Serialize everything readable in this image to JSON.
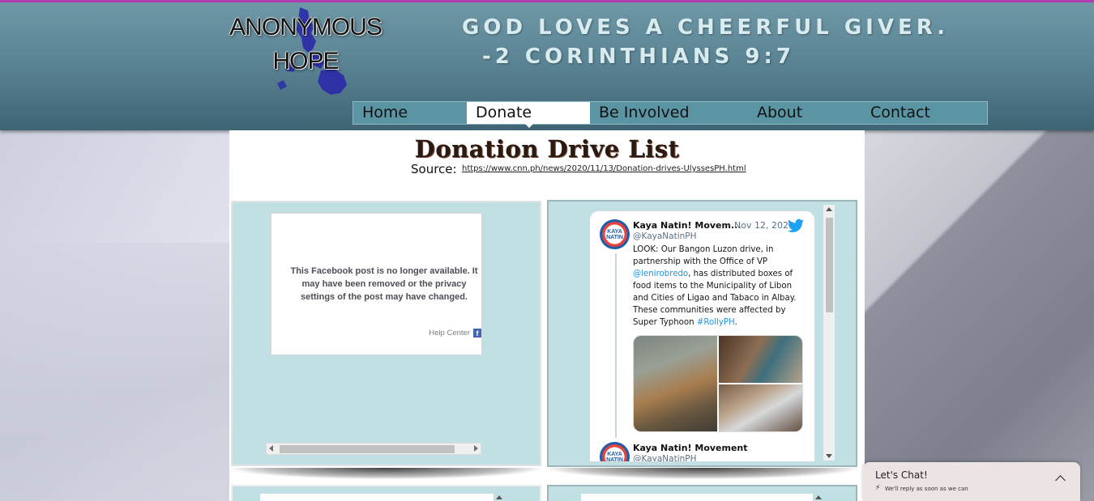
{
  "site": {
    "logo_line1": "ANONYMOUS",
    "logo_line2": "HOPE",
    "verse_line1": "GOD LOVES A CHEERFUL GIVER.",
    "verse_line2": "-2 CORINTHIANS 9:7"
  },
  "nav": {
    "items": [
      {
        "label": "Home"
      },
      {
        "label": "Donate",
        "active": true
      },
      {
        "label": "Be Involved"
      },
      {
        "label": "About"
      },
      {
        "label": "Contact"
      }
    ]
  },
  "main": {
    "title": "Donation Drive List",
    "source_label": "Source:",
    "source_link": "https://www.cnn.ph/news/2020/11/13/Donation-drives-UlyssesPH.html"
  },
  "facebook_embed": {
    "message": "This Facebook post is no longer available. It may have been removed or the privacy settings of the post may have changed.",
    "help_label": "Help Center",
    "icon": "facebook-icon"
  },
  "tweet": {
    "author": "Kaya Natin! Movem...",
    "date": "· Nov 12, 2020",
    "handle": "@KayaNatinPH",
    "avatar_text_1": "KAYA",
    "avatar_text_2": "NATIN",
    "body_1": "LOOK: Our Bangon Luzon drive, in partnership with the Office of VP ",
    "mention": "@lenirobredo",
    "body_2": ", has distributed boxes of food items to the Municipality of Libon and Cities of Ligao and Tabaco in Albay. These communities were affected by Super Typhoon ",
    "hashtag": "#RollyPH",
    "body_3": ".",
    "reply_author": "Kaya Natin! Movement",
    "reply_handle": "@KayaNatinPH",
    "icon": "twitter-bird-icon"
  },
  "chat": {
    "title": "Let's Chat!",
    "subtitle": "We'll reply as soon as we can"
  },
  "colors": {
    "header": "#5b8494",
    "nav": "#5b95a4",
    "panel": "#c1e0e4",
    "accent_border": "#b43ab0",
    "twitter_link": "#1b95e0"
  }
}
